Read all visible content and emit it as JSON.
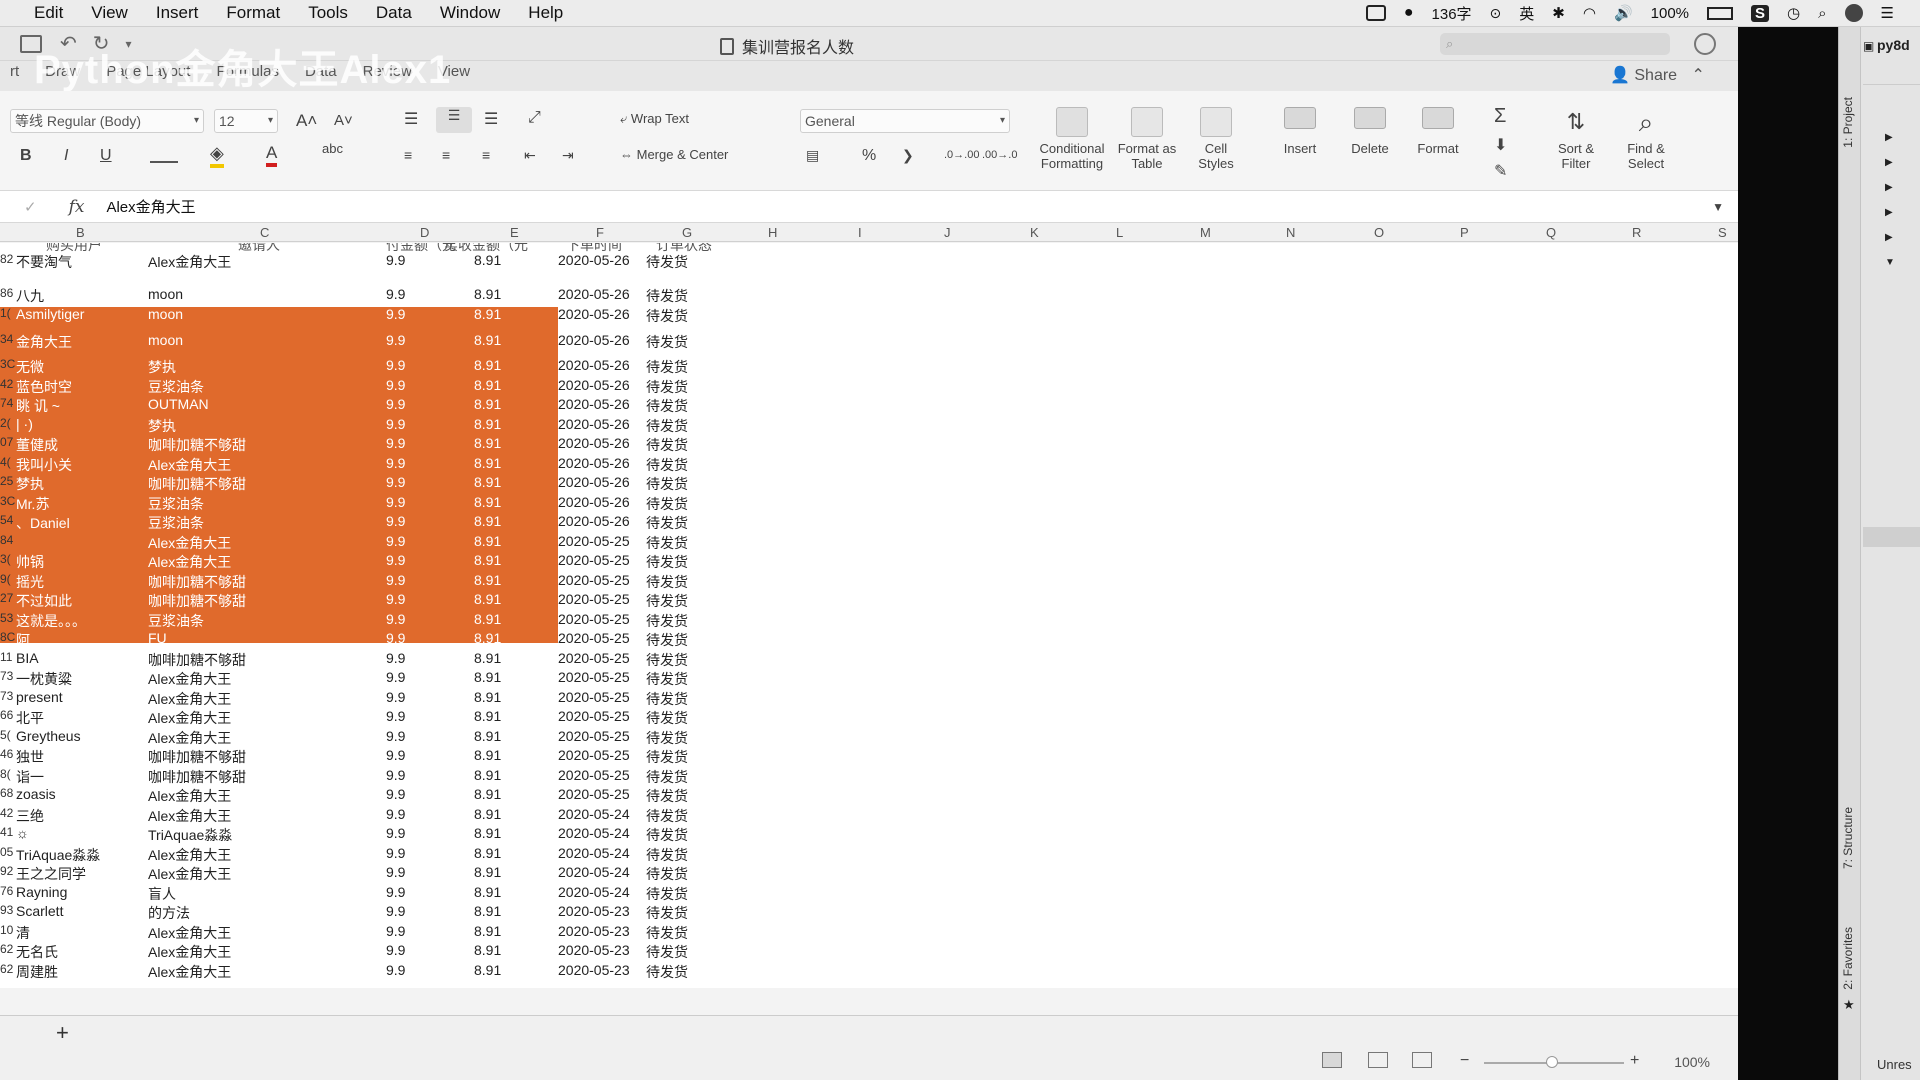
{
  "menubar": {
    "items": [
      "Edit",
      "View",
      "Insert",
      "Format",
      "Tools",
      "Data",
      "Window",
      "Help"
    ],
    "word_count": "136字",
    "input_method": "英",
    "battery": "100%"
  },
  "excel": {
    "doc_title": "集训营报名人数",
    "watermark": "Python金角大王Alex1",
    "tabs": [
      "rt",
      "Draw",
      "Page Layout",
      "Formulas",
      "Data",
      "Review",
      "View"
    ],
    "share": "Share",
    "ribbon": {
      "font_name": "等线 Regular (Body)",
      "font_size": "12",
      "wrap_text": "Wrap Text",
      "merge_center": "Merge & Center",
      "number_format": "General",
      "percent": "%",
      "conditional_formatting": "Conditional Formatting",
      "format_as_table": "Format as Table",
      "cell_styles": "Cell Styles",
      "insert": "Insert",
      "delete": "Delete",
      "format": "Format",
      "sort_filter": "Sort & Filter",
      "find_select": "Find & Select",
      "bold": "B",
      "italic": "I",
      "underline": "U"
    },
    "formula_bar": {
      "fx": "fx",
      "value": "Alex金角大王"
    },
    "columns": [
      "B",
      "C",
      "D",
      "E",
      "F",
      "G",
      "H",
      "I",
      "J",
      "K",
      "L",
      "M",
      "N",
      "O",
      "P",
      "Q",
      "R",
      "S"
    ],
    "header_partial": [
      "购买用户",
      "邀请人",
      "付金额（元",
      "实收金额（元",
      "下单时间",
      "订单状态"
    ],
    "rows": [
      {
        "id": "82",
        "buyer": "不要淘气",
        "inviter": "Alex金角大王",
        "price": "9.9",
        "paid": "8.91",
        "date": "2020-05-26",
        "status": "待发货"
      },
      {
        "id": "86",
        "buyer": "八九",
        "inviter": "moon",
        "price": "9.9",
        "paid": "8.91",
        "date": "2020-05-26",
        "status": "待发货"
      },
      {
        "id": "1(",
        "buyer": "Asmilytiger",
        "inviter": "moon",
        "price": "9.9",
        "paid": "8.91",
        "date": "2020-05-26",
        "status": "待发货"
      },
      {
        "id": "34",
        "buyer": "金角大王",
        "inviter": "moon",
        "price": "9.9",
        "paid": "8.91",
        "date": "2020-05-26",
        "status": "待发货"
      },
      {
        "id": "3C",
        "buyer": "无微",
        "inviter": "梦执",
        "price": "9.9",
        "paid": "8.91",
        "date": "2020-05-26",
        "status": "待发货"
      },
      {
        "id": "42",
        "buyer": "蓝色时空",
        "inviter": "豆浆油条",
        "price": "9.9",
        "paid": "8.91",
        "date": "2020-05-26",
        "status": "待发货"
      },
      {
        "id": "74",
        "buyer": "眺 讥 ~",
        "inviter": "OUTMAN",
        "price": "9.9",
        "paid": "8.91",
        "date": "2020-05-26",
        "status": "待发货"
      },
      {
        "id": "2(",
        "buyer": "| ·)",
        "inviter": "梦执",
        "price": "9.9",
        "paid": "8.91",
        "date": "2020-05-26",
        "status": "待发货"
      },
      {
        "id": "07",
        "buyer": "董健成",
        "inviter": "咖啡加糖不够甜",
        "price": "9.9",
        "paid": "8.91",
        "date": "2020-05-26",
        "status": "待发货"
      },
      {
        "id": "4(",
        "buyer": "我叫小关",
        "inviter": "Alex金角大王",
        "price": "9.9",
        "paid": "8.91",
        "date": "2020-05-26",
        "status": "待发货"
      },
      {
        "id": "25",
        "buyer": "梦执",
        "inviter": "咖啡加糖不够甜",
        "price": "9.9",
        "paid": "8.91",
        "date": "2020-05-26",
        "status": "待发货"
      },
      {
        "id": "3C",
        "buyer": "Mr.苏",
        "inviter": "豆浆油条",
        "price": "9.9",
        "paid": "8.91",
        "date": "2020-05-26",
        "status": "待发货"
      },
      {
        "id": "54",
        "buyer": "、Daniel",
        "inviter": "豆浆油条",
        "price": "9.9",
        "paid": "8.91",
        "date": "2020-05-26",
        "status": "待发货"
      },
      {
        "id": "84",
        "buyer": "",
        "inviter": "Alex金角大王",
        "price": "9.9",
        "paid": "8.91",
        "date": "2020-05-25",
        "status": "待发货"
      },
      {
        "id": "3(",
        "buyer": "帅锅",
        "inviter": "Alex金角大王",
        "price": "9.9",
        "paid": "8.91",
        "date": "2020-05-25",
        "status": "待发货"
      },
      {
        "id": "9(",
        "buyer": "摇光",
        "inviter": "咖啡加糖不够甜",
        "price": "9.9",
        "paid": "8.91",
        "date": "2020-05-25",
        "status": "待发货"
      },
      {
        "id": "27",
        "buyer": "不过如此",
        "inviter": "咖啡加糖不够甜",
        "price": "9.9",
        "paid": "8.91",
        "date": "2020-05-25",
        "status": "待发货"
      },
      {
        "id": "53",
        "buyer": "这就是。。。",
        "inviter": "豆浆油条",
        "price": "9.9",
        "paid": "8.91",
        "date": "2020-05-25",
        "status": "待发货"
      },
      {
        "id": "8C",
        "buyer": "阿",
        "inviter": "FU",
        "price": "9.9",
        "paid": "8.91",
        "date": "2020-05-25",
        "status": "待发货"
      },
      {
        "id": "11",
        "buyer": "BIA",
        "inviter": "咖啡加糖不够甜",
        "price": "9.9",
        "paid": "8.91",
        "date": "2020-05-25",
        "status": "待发货"
      },
      {
        "id": "73",
        "buyer": "一枕黄粱",
        "inviter": "Alex金角大王",
        "price": "9.9",
        "paid": "8.91",
        "date": "2020-05-25",
        "status": "待发货"
      },
      {
        "id": "73",
        "buyer": "present",
        "inviter": "Alex金角大王",
        "price": "9.9",
        "paid": "8.91",
        "date": "2020-05-25",
        "status": "待发货"
      },
      {
        "id": "66",
        "buyer": "北平",
        "inviter": "Alex金角大王",
        "price": "9.9",
        "paid": "8.91",
        "date": "2020-05-25",
        "status": "待发货"
      },
      {
        "id": "5(",
        "buyer": "Greytheus",
        "inviter": "Alex金角大王",
        "price": "9.9",
        "paid": "8.91",
        "date": "2020-05-25",
        "status": "待发货"
      },
      {
        "id": "46",
        "buyer": "独世",
        "inviter": "咖啡加糖不够甜",
        "price": "9.9",
        "paid": "8.91",
        "date": "2020-05-25",
        "status": "待发货"
      },
      {
        "id": "8(",
        "buyer": "诣一",
        "inviter": "咖啡加糖不够甜",
        "price": "9.9",
        "paid": "8.91",
        "date": "2020-05-25",
        "status": "待发货"
      },
      {
        "id": "68",
        "buyer": "zoasis",
        "inviter": "Alex金角大王",
        "price": "9.9",
        "paid": "8.91",
        "date": "2020-05-25",
        "status": "待发货"
      },
      {
        "id": "42",
        "buyer": "三绝",
        "inviter": "Alex金角大王",
        "price": "9.9",
        "paid": "8.91",
        "date": "2020-05-24",
        "status": "待发货"
      },
      {
        "id": "41",
        "buyer": "☼",
        "inviter": "TriAquae淼淼",
        "price": "9.9",
        "paid": "8.91",
        "date": "2020-05-24",
        "status": "待发货"
      },
      {
        "id": "05",
        "buyer": "TriAquae淼淼",
        "inviter": "Alex金角大王",
        "price": "9.9",
        "paid": "8.91",
        "date": "2020-05-24",
        "status": "待发货"
      },
      {
        "id": "92",
        "buyer": "王之之同学",
        "inviter": "Alex金角大王",
        "price": "9.9",
        "paid": "8.91",
        "date": "2020-05-24",
        "status": "待发货"
      },
      {
        "id": "76",
        "buyer": "Rayning",
        "inviter": "盲人",
        "price": "9.9",
        "paid": "8.91",
        "date": "2020-05-24",
        "status": "待发货"
      },
      {
        "id": "93",
        "buyer": "Scarlett",
        "inviter": "的方法",
        "price": "9.9",
        "paid": "8.91",
        "date": "2020-05-23",
        "status": "待发货"
      },
      {
        "id": "10",
        "buyer": "清",
        "inviter": "Alex金角大王",
        "price": "9.9",
        "paid": "8.91",
        "date": "2020-05-23",
        "status": "待发货"
      },
      {
        "id": "62",
        "buyer": "无名氏",
        "inviter": "Alex金角大王",
        "price": "9.9",
        "paid": "8.91",
        "date": "2020-05-23",
        "status": "待发货"
      },
      {
        "id": "62",
        "buyer": "周建胜",
        "inviter": "Alex金角大王",
        "price": "9.9",
        "paid": "8.91",
        "date": "2020-05-23",
        "status": "待发货"
      }
    ],
    "highlight_color": "#e06a2c",
    "zoom": "100%",
    "add_sheet": "+"
  },
  "ide": {
    "project_name": "py8d",
    "tab_project": "1: Project",
    "tab_structure": "7: Structure",
    "tab_favorites": "2: Favorites",
    "unresolved": "Unres"
  }
}
